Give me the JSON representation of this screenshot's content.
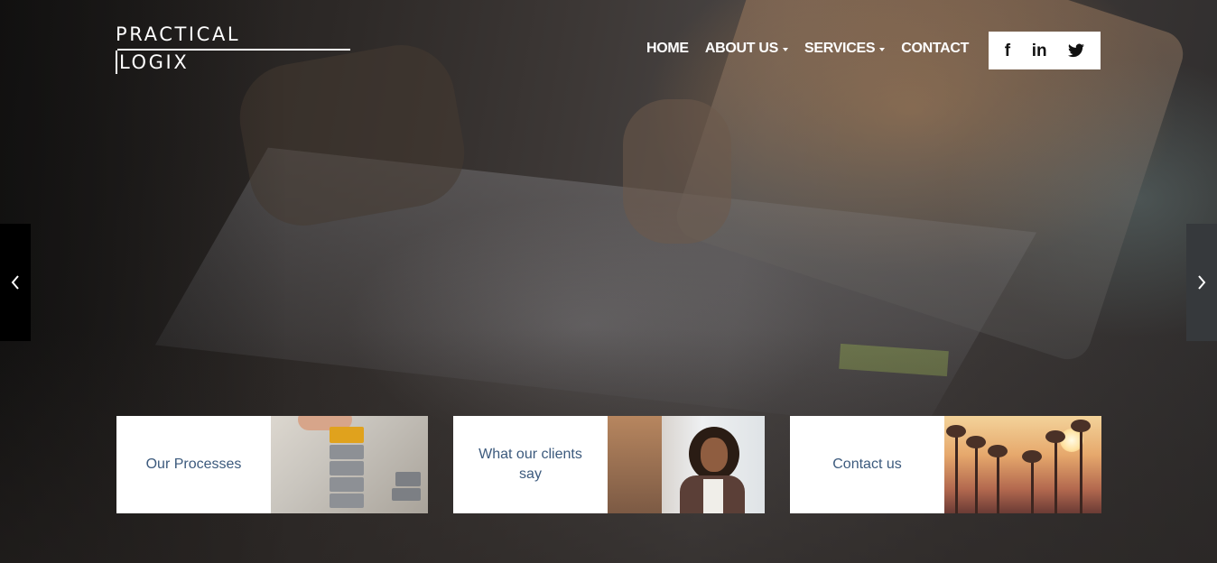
{
  "brand": {
    "line1": "PRACTICAL",
    "line2": "LOGIX"
  },
  "nav": {
    "items": [
      {
        "label": "HOME",
        "dropdown": false
      },
      {
        "label": "ABOUT US",
        "dropdown": true
      },
      {
        "label": "SERVICES",
        "dropdown": true
      },
      {
        "label": "CONTACT",
        "dropdown": false
      }
    ]
  },
  "social": {
    "facebook": "f",
    "linkedin": "in",
    "twitter_icon": "twitter-icon"
  },
  "slider": {
    "prev_icon": "chevron-left-icon",
    "next_icon": "chevron-right-icon"
  },
  "cards": [
    {
      "label": "Our Processes",
      "image": "lego-blocks-photo"
    },
    {
      "label": "What our clients say",
      "image": "smiling-woman-handshake-photo"
    },
    {
      "label": "Contact us",
      "image": "palm-trees-sunset-photo"
    }
  ],
  "colors": {
    "card_text": "#3c5a7d",
    "nav_text": "#ffffff",
    "social_bg": "#ffffff"
  }
}
